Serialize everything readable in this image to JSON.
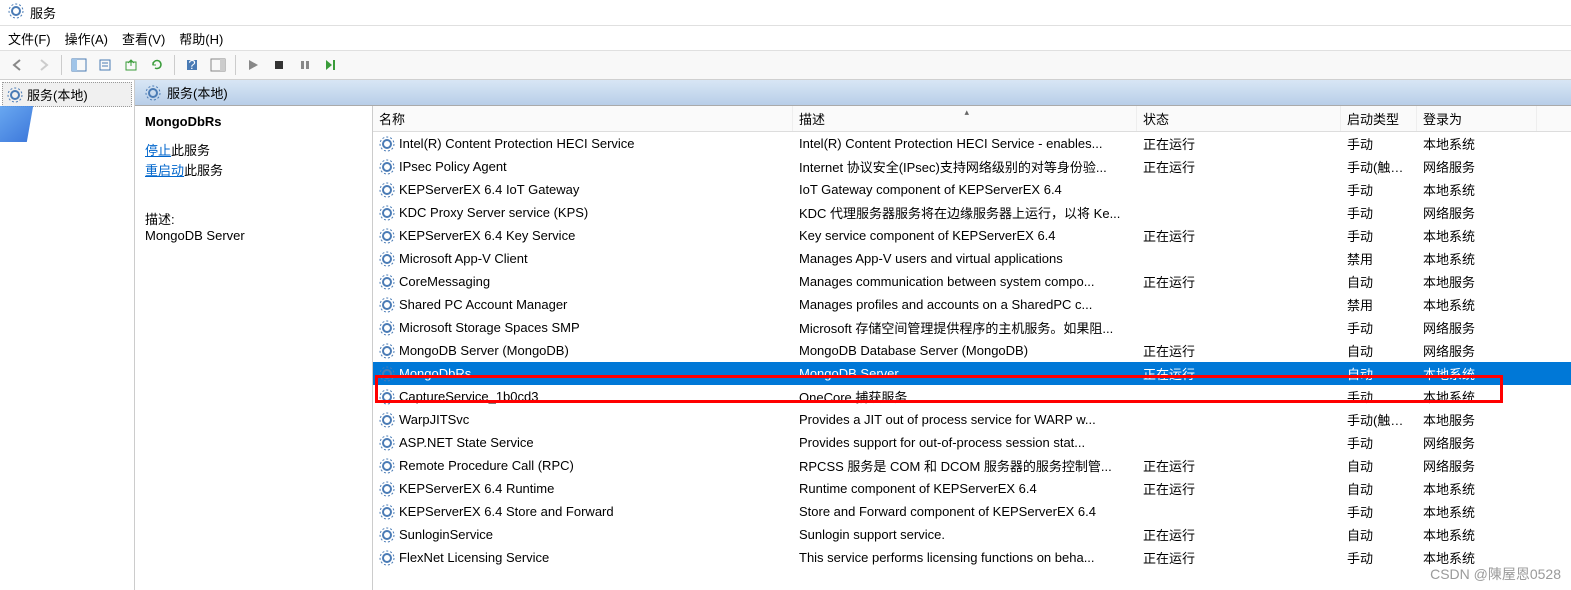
{
  "window": {
    "title": "服务"
  },
  "menu": {
    "file": "文件(F)",
    "action": "操作(A)",
    "view": "查看(V)",
    "help": "帮助(H)"
  },
  "tree": {
    "root": "服务(本地)"
  },
  "content_header": "服务(本地)",
  "detail": {
    "selected_name": "MongoDbRs",
    "stop_link": "停止",
    "stop_suffix": "此服务",
    "restart_link": "重启动",
    "restart_suffix": "此服务",
    "desc_label": "描述:",
    "desc_value": "MongoDB Server"
  },
  "columns": {
    "name": "名称",
    "desc": "描述",
    "status": "状态",
    "startup": "启动类型",
    "logon": "登录为"
  },
  "services": [
    {
      "name": "Intel(R) Content Protection HECI Service",
      "desc": "Intel(R) Content Protection HECI Service - enables...",
      "status": "正在运行",
      "startup": "手动",
      "logon": "本地系统"
    },
    {
      "name": "IPsec Policy Agent",
      "desc": "Internet 协议安全(IPsec)支持网络级别的对等身份验...",
      "status": "正在运行",
      "startup": "手动(触发...",
      "logon": "网络服务"
    },
    {
      "name": "KEPServerEX 6.4 IoT Gateway",
      "desc": "IoT Gateway component of KEPServerEX 6.4",
      "status": "",
      "startup": "手动",
      "logon": "本地系统"
    },
    {
      "name": "KDC Proxy Server service (KPS)",
      "desc": "KDC 代理服务器服务将在边缘服务器上运行，以将 Ke...",
      "status": "",
      "startup": "手动",
      "logon": "网络服务"
    },
    {
      "name": "KEPServerEX 6.4 Key Service",
      "desc": "Key service component of KEPServerEX 6.4",
      "status": "正在运行",
      "startup": "手动",
      "logon": "本地系统"
    },
    {
      "name": "Microsoft App-V Client",
      "desc": "Manages App-V users and virtual applications",
      "status": "",
      "startup": "禁用",
      "logon": "本地系统"
    },
    {
      "name": "CoreMessaging",
      "desc": "Manages communication between system compo...",
      "status": "正在运行",
      "startup": "自动",
      "logon": "本地服务"
    },
    {
      "name": "Shared PC Account Manager",
      "desc": "Manages profiles and accounts on a SharedPC c...",
      "status": "",
      "startup": "禁用",
      "logon": "本地系统"
    },
    {
      "name": "Microsoft Storage Spaces SMP",
      "desc": "Microsoft 存储空间管理提供程序的主机服务。如果阻...",
      "status": "",
      "startup": "手动",
      "logon": "网络服务"
    },
    {
      "name": "MongoDB Server (MongoDB)",
      "desc": "MongoDB Database Server (MongoDB)",
      "status": "正在运行",
      "startup": "自动",
      "logon": "网络服务"
    },
    {
      "name": "MongoDbRs",
      "desc": "MongoDB Server",
      "status": "正在运行",
      "startup": "自动",
      "logon": "本地系统",
      "selected": true
    },
    {
      "name": "CaptureService_1b0cd3",
      "desc": "OneCore 捕获服务",
      "status": "",
      "startup": "手动",
      "logon": "本地系统"
    },
    {
      "name": "WarpJITSvc",
      "desc": "Provides a JIT out of process service for WARP w...",
      "status": "",
      "startup": "手动(触发...",
      "logon": "本地服务"
    },
    {
      "name": "ASP.NET State Service",
      "desc": "Provides support for out-of-process session stat...",
      "status": "",
      "startup": "手动",
      "logon": "网络服务"
    },
    {
      "name": "Remote Procedure Call (RPC)",
      "desc": "RPCSS 服务是 COM 和 DCOM 服务器的服务控制管...",
      "status": "正在运行",
      "startup": "自动",
      "logon": "网络服务"
    },
    {
      "name": "KEPServerEX 6.4 Runtime",
      "desc": "Runtime component of KEPServerEX 6.4",
      "status": "正在运行",
      "startup": "自动",
      "logon": "本地系统"
    },
    {
      "name": "KEPServerEX 6.4 Store and Forward",
      "desc": "Store and Forward component of KEPServerEX 6.4",
      "status": "",
      "startup": "手动",
      "logon": "本地系统"
    },
    {
      "name": "SunloginService",
      "desc": "Sunlogin support service.",
      "status": "正在运行",
      "startup": "自动",
      "logon": "本地系统"
    },
    {
      "name": "FlexNet Licensing Service",
      "desc": "This service performs licensing functions on beha...",
      "status": "正在运行",
      "startup": "手动",
      "logon": "本地系统"
    }
  ],
  "watermark": "CSDN @陳屋恩0528"
}
